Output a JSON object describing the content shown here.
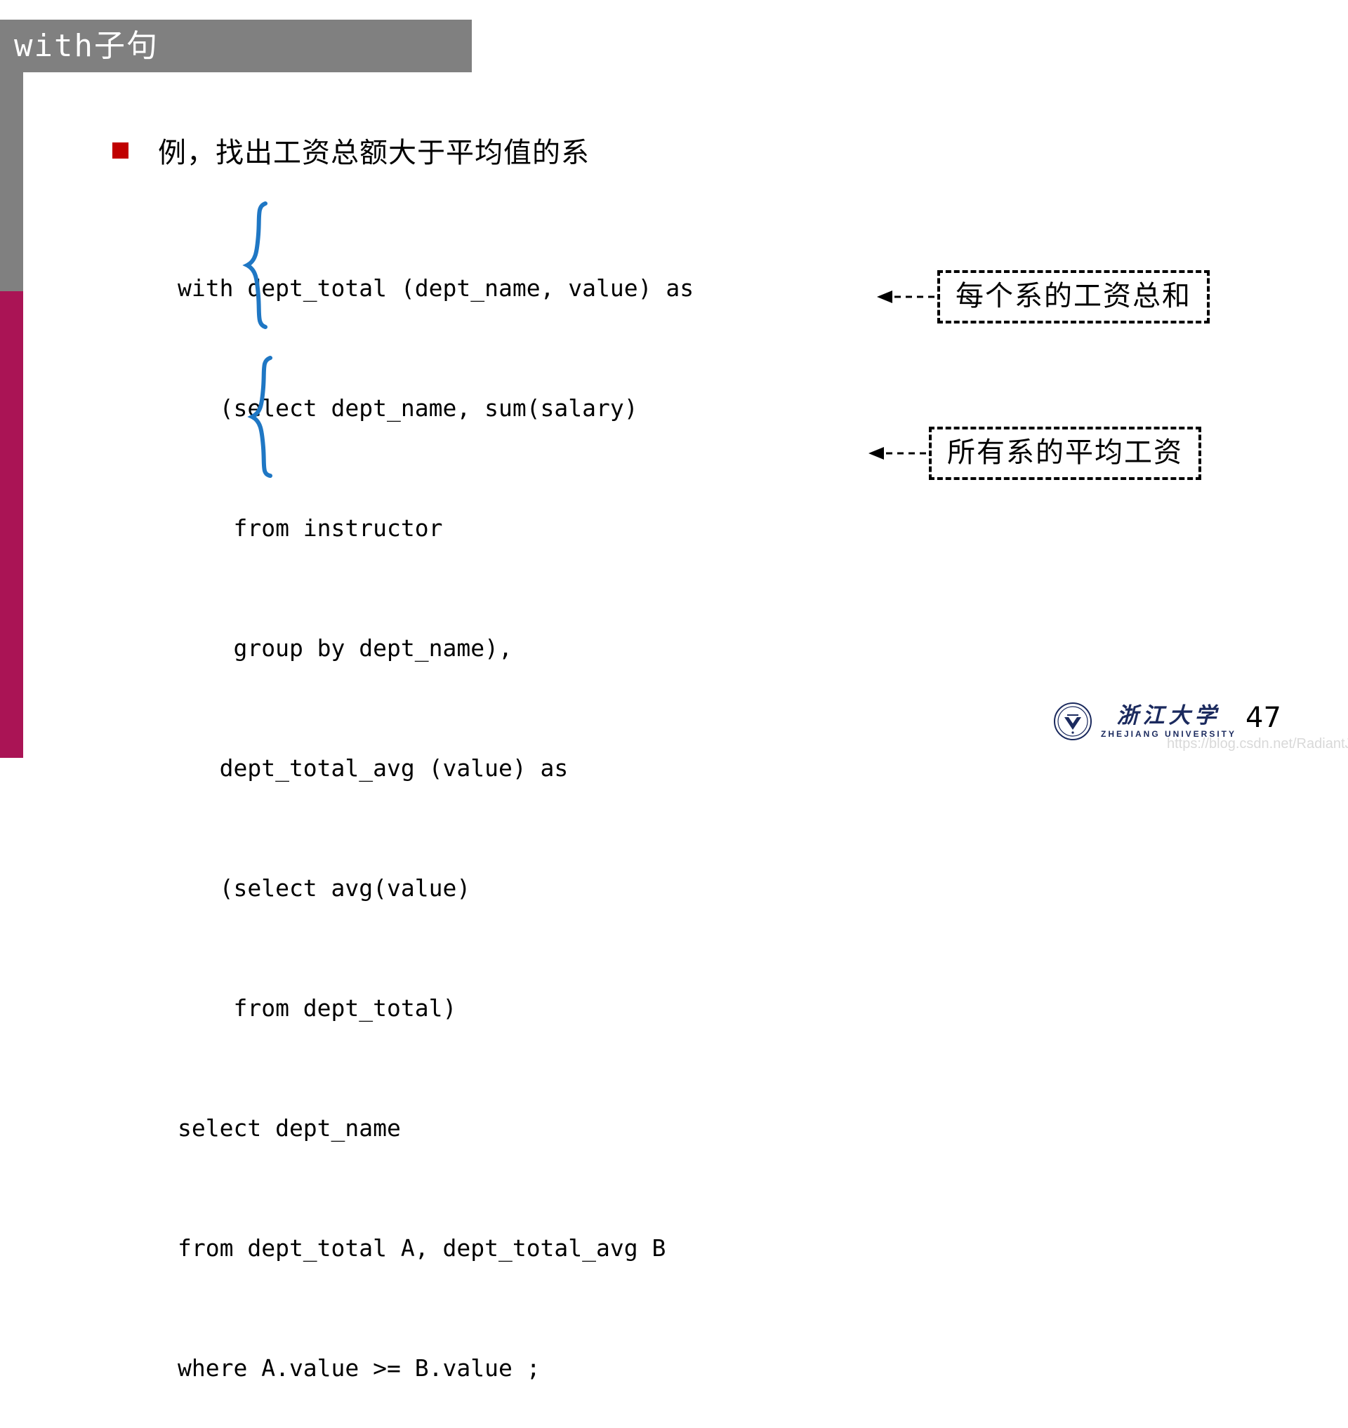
{
  "slide": {
    "title": "with子句",
    "bullet": {
      "marker_color": "#C00000",
      "text": "例，找出工资总额大于平均值的系"
    },
    "sql_lines": [
      {
        "id": "line-1",
        "text": "with dept_total (dept_name, value) as"
      },
      {
        "id": "line-2",
        "text": "   (select dept_name, sum(salary)"
      },
      {
        "id": "line-3",
        "text": "    from instructor"
      },
      {
        "id": "line-4",
        "text": "    group by dept_name),"
      },
      {
        "id": "line-5",
        "text": "   dept_total_avg (value) as"
      },
      {
        "id": "line-6",
        "text": "   (select avg(value)"
      },
      {
        "id": "line-7",
        "text": "    from dept_total)"
      },
      {
        "id": "line-8",
        "text": "select dept_name"
      },
      {
        "id": "line-9",
        "text": "from dept_total A, dept_total_avg B"
      },
      {
        "id": "line-10",
        "text": "where A.value >= B.value ;"
      }
    ],
    "callouts": [
      {
        "id": "callout-1",
        "text": "每个系的工资总和"
      },
      {
        "id": "callout-2",
        "text": "所有系的平均工资"
      }
    ],
    "footer": {
      "logo_cn": "浙江大学",
      "logo_en": "ZHEJIANG UNIVERSITY",
      "page_number": "47",
      "watermark": "https://blog.csdn.net/RadiantJeral"
    },
    "colors": {
      "banner_gray": "#808080",
      "sidebar_crimson": "#AA1455",
      "bullet_red": "#C00000",
      "brace_blue": "#1F77C4",
      "logo_navy": "#1B2A5E"
    }
  }
}
